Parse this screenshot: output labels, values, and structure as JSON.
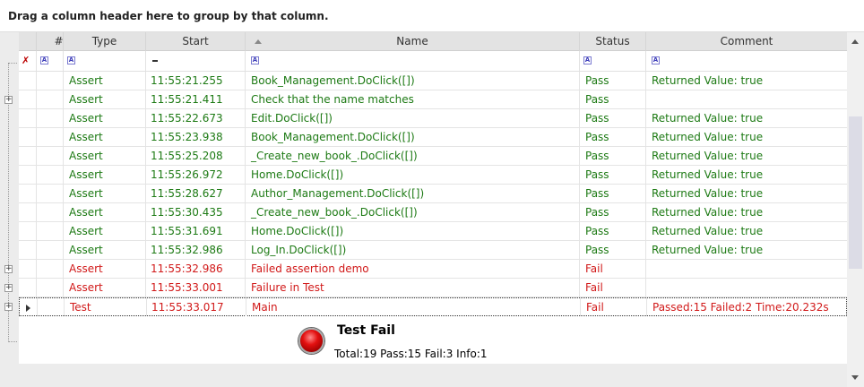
{
  "group_panel": {
    "text": "Drag a column header here to group by that column."
  },
  "columns": {
    "num": "#",
    "type": "Type",
    "start": "Start",
    "name": "Name",
    "status": "Status",
    "comment": "Comment"
  },
  "filter_icons": {
    "pin": "pin-icon",
    "text_filter": "text-filter-icon",
    "date_filter": "date-filter-icon"
  },
  "rows": [
    {
      "type": "Assert",
      "start": "11:55:21.255",
      "name": "Book_Management.DoClick([])",
      "status": "Pass",
      "comment": "Returned Value: true"
    },
    {
      "type": "Assert",
      "start": "11:55:21.411",
      "name": "Check that the name matches",
      "status": "Pass",
      "comment": ""
    },
    {
      "type": "Assert",
      "start": "11:55:22.673",
      "name": "Edit.DoClick([])",
      "status": "Pass",
      "comment": "Returned Value: true"
    },
    {
      "type": "Assert",
      "start": "11:55:23.938",
      "name": "Book_Management.DoClick([])",
      "status": "Pass",
      "comment": "Returned Value: true"
    },
    {
      "type": "Assert",
      "start": "11:55:25.208",
      "name": "_Create_new_book_.DoClick([])",
      "status": "Pass",
      "comment": "Returned Value: true"
    },
    {
      "type": "Assert",
      "start": "11:55:26.972",
      "name": "Home.DoClick([])",
      "status": "Pass",
      "comment": "Returned Value: true"
    },
    {
      "type": "Assert",
      "start": "11:55:28.627",
      "name": "Author_Management.DoClick([])",
      "status": "Pass",
      "comment": "Returned Value: true"
    },
    {
      "type": "Assert",
      "start": "11:55:30.435",
      "name": "_Create_new_book_.DoClick([])",
      "status": "Pass",
      "comment": "Returned Value: true"
    },
    {
      "type": "Assert",
      "start": "11:55:31.691",
      "name": "Home.DoClick([])",
      "status": "Pass",
      "comment": "Returned Value: true"
    },
    {
      "type": "Assert",
      "start": "11:55:32.986",
      "name": "Log_In.DoClick([])",
      "status": "Pass",
      "comment": "Returned Value: true"
    },
    {
      "type": "Assert",
      "start": "11:55:32.986",
      "name": "Failed assertion demo",
      "status": "Fail",
      "comment": ""
    },
    {
      "type": "Assert",
      "start": "11:55:33.001",
      "name": "Failure in Test",
      "status": "Fail",
      "comment": ""
    },
    {
      "type": "Test",
      "start": "11:55:33.017",
      "name": "Main",
      "status": "Fail",
      "comment": "Passed:15 Failed:2 Time:20.232s"
    }
  ],
  "summary": {
    "title": "Test Fail",
    "stats": "Total:19 Pass:15 Fail:3 Info:1",
    "icon": "red-status-orb-icon"
  },
  "colors": {
    "pass": "#1d7a14",
    "fail": "#d11919",
    "header_bg": "#e3e3e3"
  }
}
